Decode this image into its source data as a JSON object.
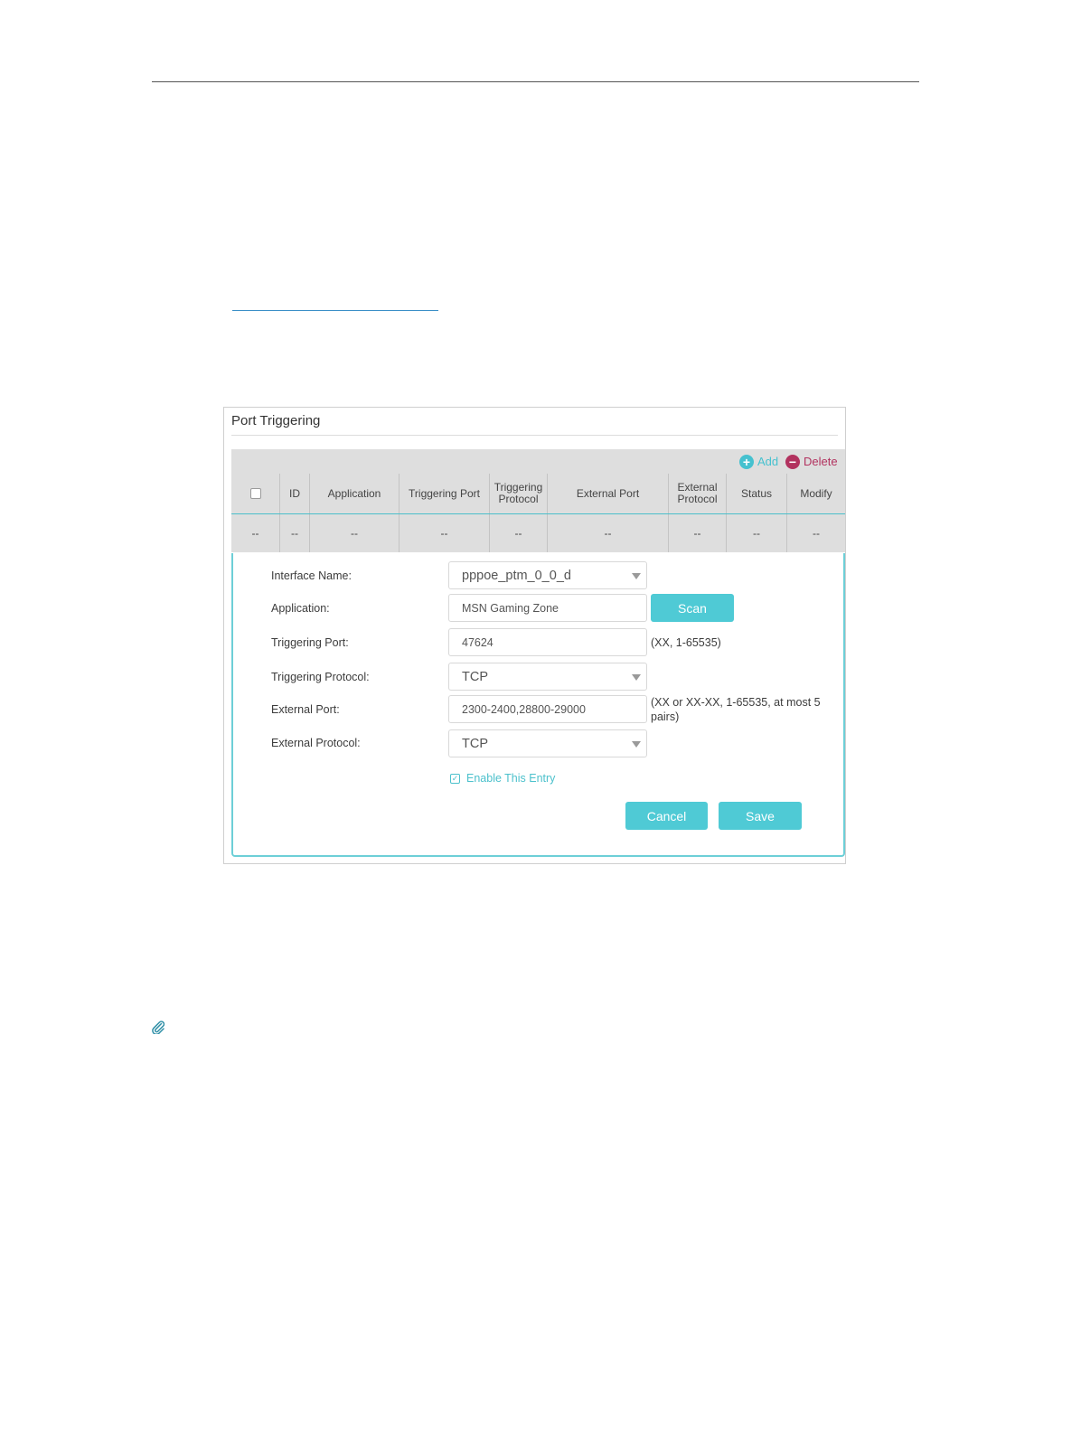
{
  "panel": {
    "title": "Port Triggering",
    "toolbar": {
      "add_label": "Add",
      "delete_label": "Delete"
    },
    "columns": [
      "ID",
      "Application",
      "Triggering Port",
      "Triggering Protocol",
      "External Port",
      "External Protocol",
      "Status",
      "Modify"
    ],
    "empty_row": [
      "--",
      "--",
      "--",
      "--",
      "--",
      "--",
      "--",
      "--",
      "--"
    ]
  },
  "form": {
    "interface_name": {
      "label": "Interface Name:",
      "value": "pppoe_ptm_0_0_d"
    },
    "application": {
      "label": "Application:",
      "value": "MSN Gaming Zone",
      "scan_label": "Scan"
    },
    "triggering_port": {
      "label": "Triggering Port:",
      "value": "47624",
      "hint": "(XX, 1-65535)"
    },
    "triggering_protocol": {
      "label": "Triggering Protocol:",
      "value": "TCP"
    },
    "external_port": {
      "label": "External Port:",
      "value": "2300-2400,28800-29000",
      "hint": "(XX or XX-XX, 1-65535, at most 5 pairs)"
    },
    "external_protocol": {
      "label": "External Protocol:",
      "value": "TCP"
    },
    "enable_entry": {
      "label": "Enable This Entry",
      "checked": true
    },
    "cancel_label": "Cancel",
    "save_label": "Save"
  },
  "colors": {
    "accent": "#4fcad5",
    "delete": "#b2325f",
    "header_bg": "#dedede"
  },
  "icons": {
    "add": "plus-circle-icon",
    "delete": "minus-circle-icon",
    "note": "paperclip-icon"
  }
}
